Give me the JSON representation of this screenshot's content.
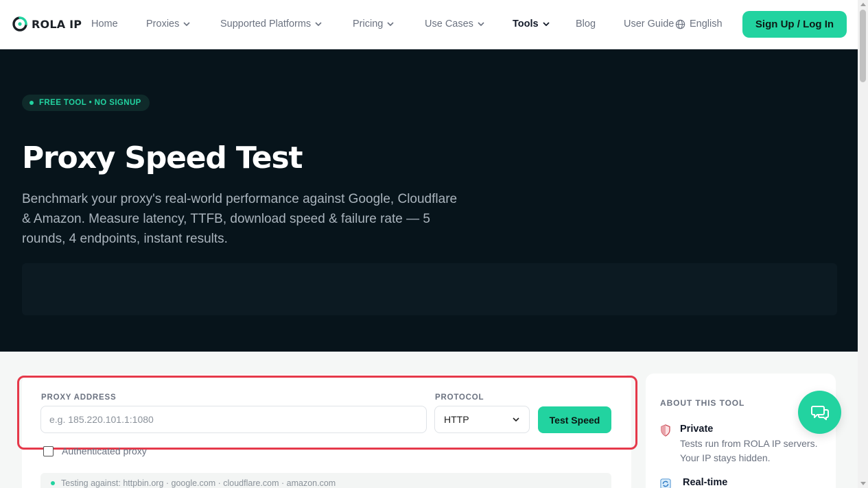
{
  "nav": {
    "logo_text": "ROLA IP",
    "items": [
      {
        "label": "Home",
        "dropdown": false
      },
      {
        "label": "Proxies",
        "dropdown": true
      },
      {
        "label": "Supported Platforms",
        "dropdown": true
      },
      {
        "label": "Pricing",
        "dropdown": true
      },
      {
        "label": "Use Cases",
        "dropdown": true
      },
      {
        "label": "Tools",
        "dropdown": true,
        "active": true
      },
      {
        "label": "Blog",
        "dropdown": false
      },
      {
        "label": "User Guide",
        "dropdown": false
      }
    ],
    "language": "English",
    "signup_label": "Sign Up / Log In"
  },
  "hero": {
    "badge": "FREE TOOL • NO SIGNUP",
    "title": "Proxy Speed Test",
    "description": "Benchmark your proxy's real-world performance against Google, Cloudflare & Amazon. Measure latency, TTFB, download speed & failure rate — 5 rounds, 4 endpoints, instant results."
  },
  "form": {
    "proxy_label": "PROXY ADDRESS",
    "proxy_placeholder": "e.g. 185.220.101.1:1080",
    "proxy_value": "",
    "protocol_label": "PROTOCOL",
    "protocol_value": "HTTP",
    "test_button": "Test Speed",
    "auth_label": "Authenticated proxy",
    "auth_checked": false,
    "testing_against": "Testing against: httpbin.org · google.com · cloudflare.com · amazon.com"
  },
  "sidebar": {
    "title": "ABOUT THIS TOOL",
    "features": [
      {
        "icon": "shield-icon",
        "title": "Private",
        "desc": "Tests run from ROLA IP servers. Your IP stays hidden."
      },
      {
        "icon": "refresh-icon",
        "title": "Real-time",
        "desc": ""
      }
    ]
  },
  "colors": {
    "accent": "#22d3a0",
    "hero_bg": "#07141b",
    "highlight": "#e5394a"
  }
}
